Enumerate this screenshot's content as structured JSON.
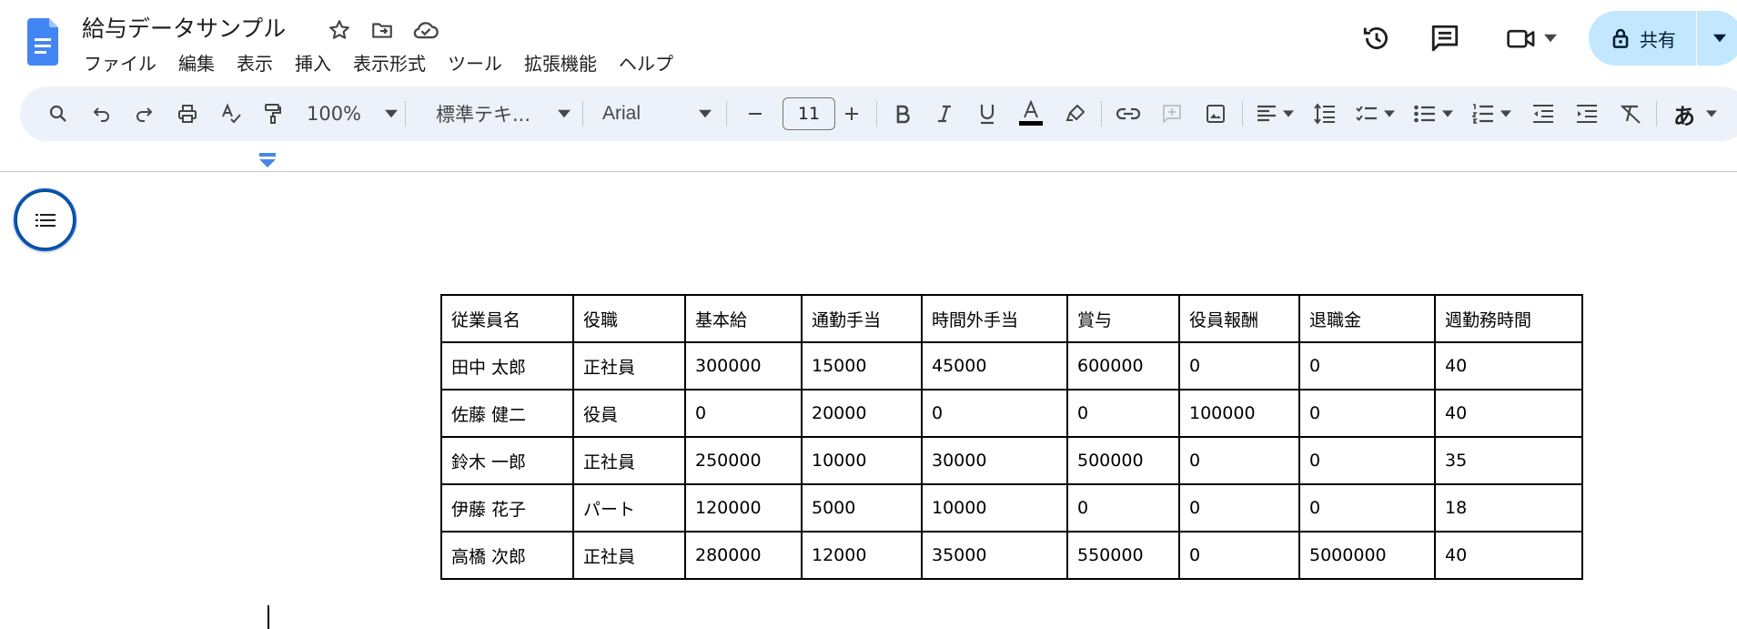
{
  "document": {
    "title": "給与データサンプル"
  },
  "menu": [
    "ファイル",
    "編集",
    "表示",
    "挿入",
    "表示形式",
    "ツール",
    "拡張機能",
    "ヘルプ"
  ],
  "header_actions": {
    "share_label": "共有"
  },
  "toolbar": {
    "zoom": "100%",
    "style": "標準テキ...",
    "font": "Arial",
    "font_size": "11",
    "input_tools_label": "あ",
    "text_color": "#000000"
  },
  "table": {
    "headers": [
      "従業員名",
      "役職",
      "基本給",
      "通勤手当",
      "時間外手当",
      "賞与",
      "役員報酬",
      "退職金",
      "週勤務時間"
    ],
    "rows": [
      [
        "田中 太郎",
        "正社員",
        "300000",
        "15000",
        "45000",
        "600000",
        "0",
        "0",
        "40"
      ],
      [
        "佐藤 健二",
        "役員",
        "0",
        "20000",
        "0",
        "0",
        "100000",
        "0",
        "40"
      ],
      [
        "鈴木 一郎",
        "正社員",
        "250000",
        "10000",
        "30000",
        "500000",
        "0",
        "0",
        "35"
      ],
      [
        "伊藤 花子",
        "パート",
        "120000",
        "5000",
        "10000",
        "0",
        "0",
        "0",
        "18"
      ],
      [
        "高橋 次郎",
        "正社員",
        "280000",
        "12000",
        "35000",
        "550000",
        "0",
        "5000000",
        "40"
      ]
    ]
  },
  "colors": {
    "accent": "#0b57d0",
    "share_bg": "#c2e7ff",
    "toolbar_bg": "#edf2fa",
    "docs_blue": "#4285f4"
  }
}
